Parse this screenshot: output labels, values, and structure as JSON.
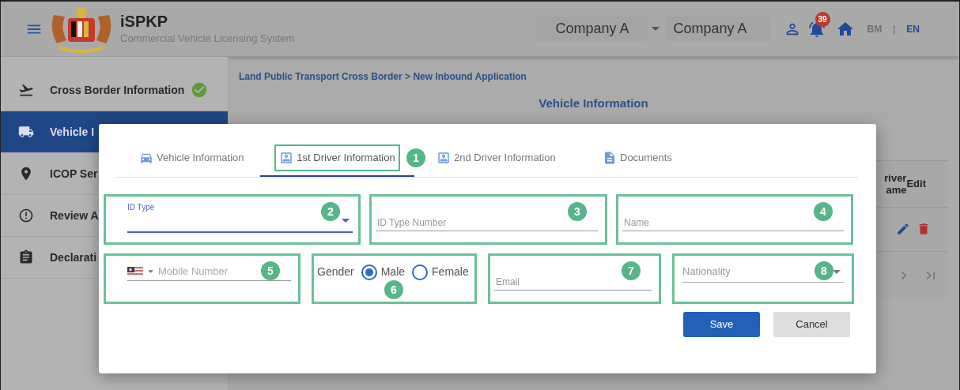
{
  "header": {
    "title": "iSPKP",
    "subtitle": "Commercial Vehicle Licensing System",
    "company_select": {
      "value": "Company A"
    },
    "company_field": {
      "value": "Company A"
    },
    "notification_count": "39",
    "language_separator": "|",
    "languages": [
      {
        "label": "BM",
        "selected": false
      },
      {
        "label": "EN",
        "selected": true
      }
    ]
  },
  "sidebar": {
    "items": [
      {
        "label": "Cross Border Information",
        "kind": "plane",
        "completed": true,
        "selected": false
      },
      {
        "label": "Vehicle I",
        "kind": "truck",
        "selected": true
      },
      {
        "label": "ICOP Ser",
        "kind": "pin",
        "selected": false
      },
      {
        "label": "Review A",
        "kind": "alert",
        "selected": false
      },
      {
        "label": "Declarati",
        "kind": "clipboard",
        "selected": false
      }
    ]
  },
  "breadcrumb": "Land Public Transport Cross Border > New Inbound Application",
  "page_heading": "Vehicle Information",
  "table": {
    "columns": [
      {
        "label": "river ame"
      },
      {
        "label": "Edit"
      }
    ]
  },
  "dialog": {
    "tabs": [
      {
        "label": "Vehicle Information",
        "kind": "car",
        "selected": false
      },
      {
        "label": "1st Driver Information",
        "kind": "person",
        "selected": true,
        "callout": "1"
      },
      {
        "label": "2nd Driver Information",
        "kind": "person",
        "selected": false
      },
      {
        "label": "Documents",
        "kind": "document",
        "selected": false
      }
    ],
    "fields": [
      {
        "kind": "select",
        "label": "ID Type",
        "focused": true,
        "callout": "2"
      },
      {
        "kind": "text",
        "placeholder": "ID Type Number",
        "callout": "3"
      },
      {
        "kind": "text",
        "placeholder": "Name",
        "callout": "4"
      },
      {
        "kind": "phone",
        "placeholder": "Mobile Number",
        "callout": "5"
      },
      {
        "kind": "radio",
        "label": "Gender",
        "options": [
          {
            "label": "Male",
            "selected": true
          },
          {
            "label": "Female",
            "selected": false
          }
        ],
        "callout": "6"
      },
      {
        "kind": "text",
        "placeholder": "Email",
        "callout": "7"
      },
      {
        "kind": "select",
        "placeholder": "Nationality",
        "focused": false,
        "callout": "8"
      }
    ],
    "buttons": [
      {
        "label": "Save",
        "kind": "primary"
      },
      {
        "label": "Cancel",
        "kind": "secondary"
      }
    ]
  }
}
